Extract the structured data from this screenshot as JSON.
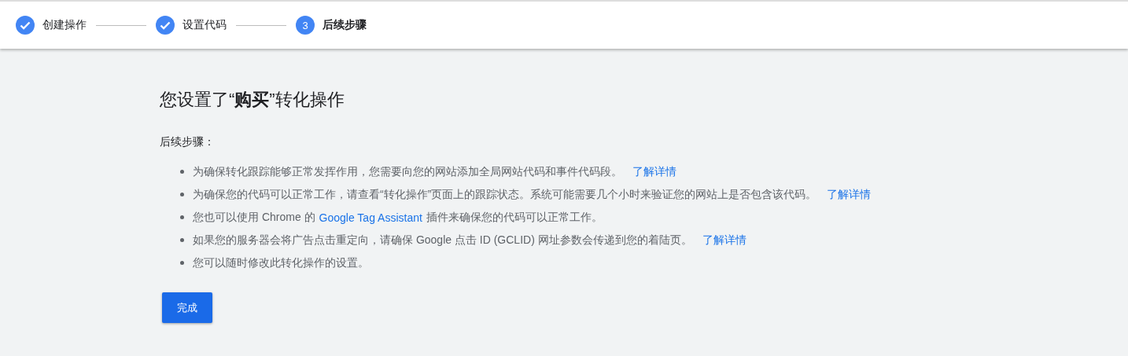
{
  "stepper": [
    {
      "label": "创建操作",
      "completed": true
    },
    {
      "label": "设置代码",
      "completed": true
    },
    {
      "label": "后续步骤",
      "completed": false,
      "number": "3"
    }
  ],
  "title": "您设置了“**购买**”转化操作",
  "subheading": "后续步骤：",
  "bullets": [
    [
      {
        "kind": "text",
        "text": "为确保转化跟踪能够正常发挥作用，您需要向您的网站添加全局网站代码和事件代码段。"
      },
      {
        "kind": "link",
        "text": "了解详情"
      }
    ],
    [
      {
        "kind": "text",
        "text": "为确保您的代码可以正常工作，请查看“转化操作”页面上的跟踪状态。系统可能需要几个小时来验证您的网站上是否包含该代码。"
      },
      {
        "kind": "link",
        "text": "了解详情"
      }
    ],
    [
      {
        "kind": "text",
        "text": "您也可以使用 Chrome 的"
      },
      {
        "kind": "link",
        "text": "Google Tag Assistant"
      },
      {
        "kind": "text",
        "text": "插件来确保您的代码可以正常工作。"
      }
    ],
    [
      {
        "kind": "text",
        "text": "如果您的服务器会将广告点击重定向，请确保 Google 点击 ID (GCLID) 网址参数会传递到您的着陆页。"
      },
      {
        "kind": "link",
        "text": "了解详情"
      }
    ],
    [
      {
        "kind": "text",
        "text": "您可以随时修改此转化操作的设置。"
      }
    ]
  ],
  "done_button": "完成"
}
